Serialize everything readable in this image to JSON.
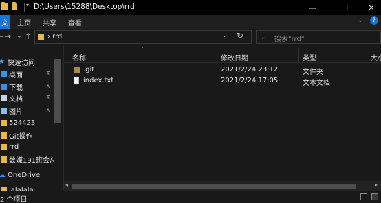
{
  "window": {
    "title": "D:\\Users\\15288\\Desktop\\rrd",
    "minimize_glyph": "—",
    "maximize_glyph": "☐",
    "close_glyph": "✕"
  },
  "ribbon": {
    "file_tab": "文件",
    "tabs": [
      "主页",
      "共享",
      "查看"
    ]
  },
  "nav": {
    "back_glyph": "←",
    "forward_glyph": "→",
    "recent_glyph": "⌄",
    "up_glyph": "↑",
    "breadcrumb": "›  rrd",
    "dropdown_glyph": "⌄",
    "refresh_glyph": "↻",
    "search_placeholder": "搜索\"rrd\""
  },
  "sidebar": {
    "items": [
      {
        "label": "快速访问",
        "icon": "star-icon"
      },
      {
        "label": "桌面",
        "icon": "desktop-icon",
        "pinned": true
      },
      {
        "label": "下载",
        "icon": "download-icon",
        "pinned": true
      },
      {
        "label": "文档",
        "icon": "document-icon",
        "pinned": true
      },
      {
        "label": "图片",
        "icon": "pictures-icon",
        "pinned": true
      },
      {
        "label": "524423",
        "icon": "folder-icon"
      },
      {
        "label": "Git操作",
        "icon": "folder-icon"
      },
      {
        "label": "rrd",
        "icon": "folder-icon"
      },
      {
        "label": "数媒191班会总结",
        "icon": "folder-icon"
      },
      {
        "label": "OneDrive",
        "icon": "cloud-icon"
      },
      {
        "label": "lalalala",
        "icon": "folder-icon"
      }
    ],
    "pin_glyph": "📌"
  },
  "list": {
    "columns": [
      "名称",
      "修改日期",
      "类型",
      "大小"
    ],
    "rows": [
      {
        "name": ".git",
        "modified": "2021/2/24 23:12",
        "type": "文件夹",
        "icon": "folder-icon"
      },
      {
        "name": "index.txt",
        "modified": "2021/2/24 17:05",
        "type": "文本文档",
        "icon": "text-file-icon"
      }
    ]
  },
  "status": {
    "text": "2 个项目"
  }
}
